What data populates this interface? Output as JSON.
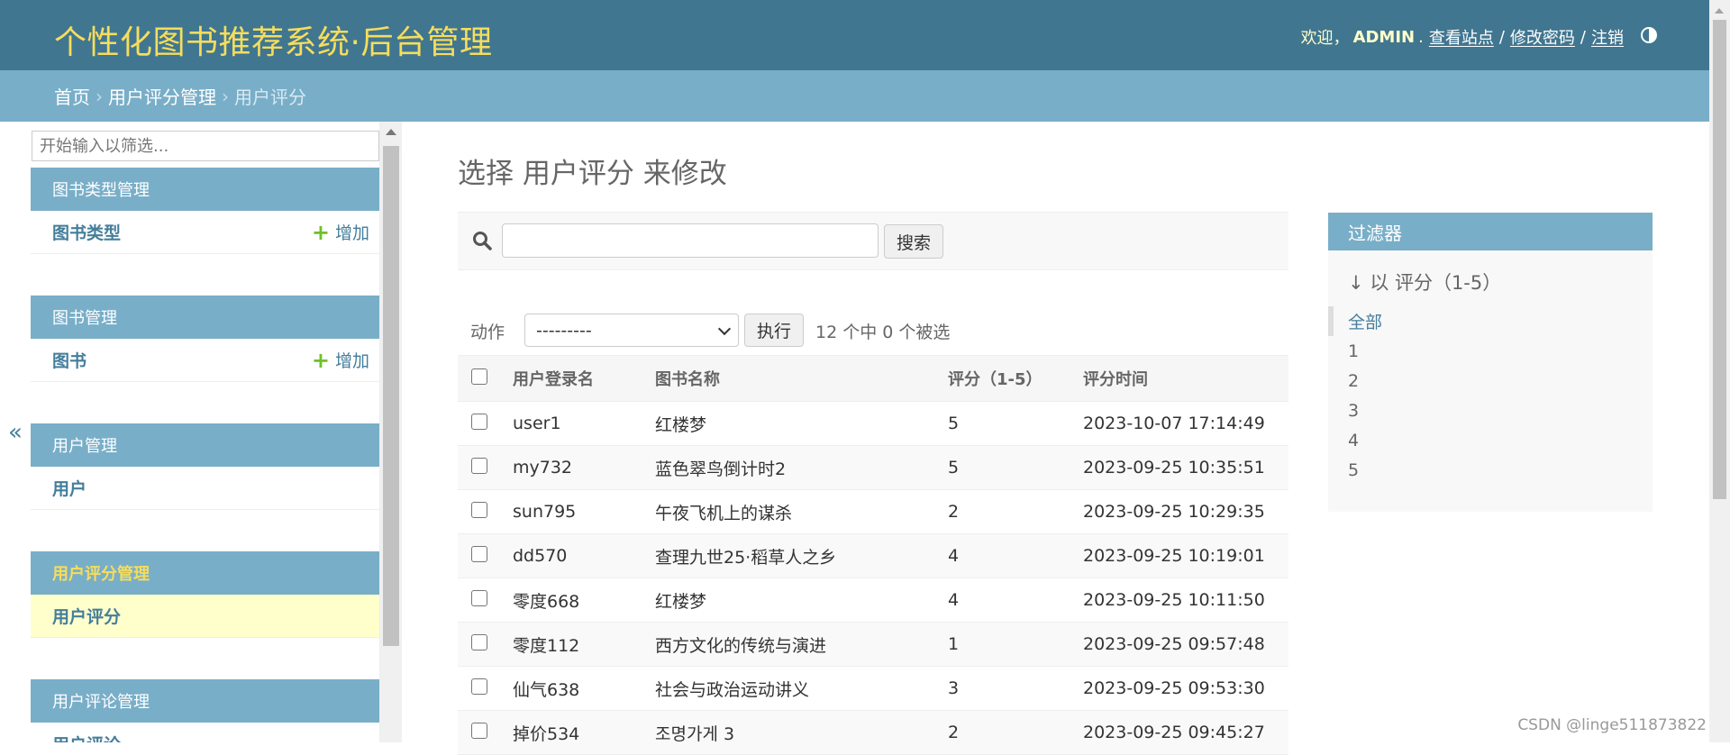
{
  "header": {
    "site_title": "个性化图书推荐系统·后台管理",
    "welcome": "欢迎，",
    "username": "ADMIN",
    "period": ".",
    "view_site": "查看站点",
    "sep1": "/",
    "change_password": "修改密码",
    "sep2": "/",
    "logout": "注销"
  },
  "breadcrumbs": {
    "home": "首页",
    "sep": "›",
    "app": "用户评分管理",
    "current": "用户评分"
  },
  "sidebar": {
    "toggle": "«",
    "filter_placeholder": "开始输入以筛选...",
    "modules": [
      {
        "caption": "图书类型管理",
        "model": "图书类型",
        "add": "增加"
      },
      {
        "caption": "图书管理",
        "model": "图书",
        "add": "增加"
      },
      {
        "caption": "用户管理",
        "model": "用户"
      },
      {
        "caption": "用户评分管理",
        "model": "用户评分"
      },
      {
        "caption": "用户评论管理",
        "model": "用户评论"
      }
    ]
  },
  "main": {
    "title": "选择 用户评分 来修改",
    "search_button": "搜索",
    "action_label": "动作",
    "action_selected": "---------",
    "go_button": "执行",
    "counter": "12 个中 0 个被选",
    "columns": [
      "用户登录名",
      "图书名称",
      "评分（1-5）",
      "评分时间"
    ],
    "rows": [
      [
        "user1",
        "红楼梦",
        "5",
        "2023-10-07 17:14:49"
      ],
      [
        "my732",
        "蓝色翠鸟倒计时2",
        "5",
        "2023-09-25 10:35:51"
      ],
      [
        "sun795",
        "午夜飞机上的谋杀",
        "2",
        "2023-09-25 10:29:35"
      ],
      [
        "dd570",
        "查理九世25·稻草人之乡",
        "4",
        "2023-09-25 10:19:01"
      ],
      [
        "零度668",
        "红楼梦",
        "4",
        "2023-09-25 10:11:50"
      ],
      [
        "零度112",
        "西方文化的传统与演进",
        "1",
        "2023-09-25 09:57:48"
      ],
      [
        "仙气638",
        "社会与政治运动讲义",
        "3",
        "2023-09-25 09:53:30"
      ],
      [
        "掉价534",
        "조명가게 3",
        "2",
        "2023-09-25 09:45:27"
      ]
    ]
  },
  "filter": {
    "title": "过滤器",
    "heading": "↓ 以 评分（1-5）",
    "options": [
      "全部",
      "1",
      "2",
      "3",
      "4",
      "5"
    ]
  },
  "watermark": "CSDN @linge511873822"
}
